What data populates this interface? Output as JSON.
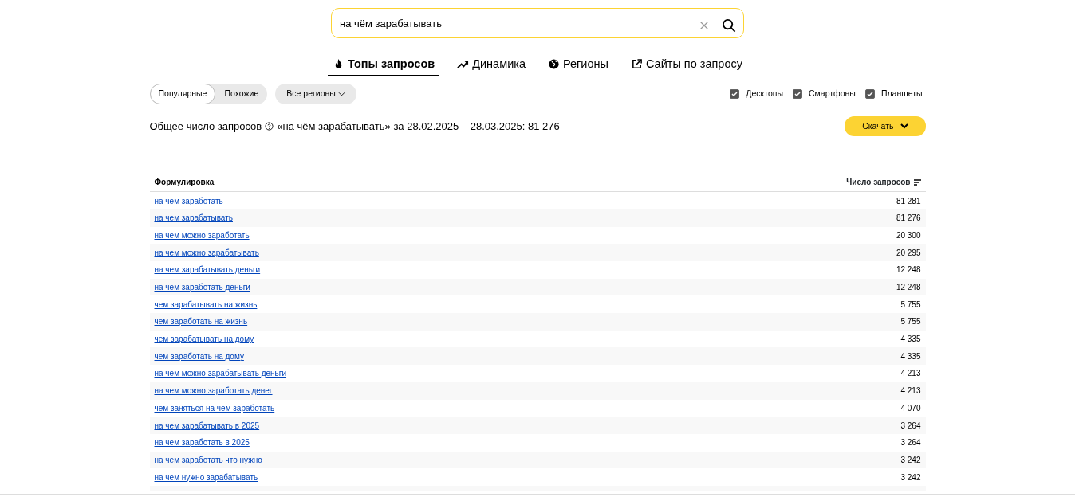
{
  "search": {
    "value": "на чём зарабатывать"
  },
  "tabs": [
    {
      "label": "Топы запросов",
      "selected": true
    },
    {
      "label": "Динамика",
      "selected": false
    },
    {
      "label": "Регионы",
      "selected": false
    },
    {
      "label": "Сайты по запросу",
      "selected": false
    }
  ],
  "modes": [
    {
      "label": "Популярные",
      "selected": true
    },
    {
      "label": "Похожие",
      "selected": false
    }
  ],
  "region_dropdown": {
    "label": "Все регионы"
  },
  "devices": [
    {
      "label": "Десктопы",
      "checked": true
    },
    {
      "label": "Смартфоны",
      "checked": true
    },
    {
      "label": "Планшеты",
      "checked": true
    }
  ],
  "summary": {
    "label": "Общее число запросов",
    "text": "«на чём зарабатывать» за 28.02.2025 – 28.03.2025: 81 276"
  },
  "download_button": {
    "label": "Скачать"
  },
  "table": {
    "columns": [
      "Формулировка",
      "Число запросов"
    ],
    "rows": [
      {
        "phrase": "на чем заработать",
        "count": "81 281"
      },
      {
        "phrase": "на чем зарабатывать",
        "count": "81 276"
      },
      {
        "phrase": "на чем можно заработать",
        "count": "20 300"
      },
      {
        "phrase": "на чем можно зарабатывать",
        "count": "20 295"
      },
      {
        "phrase": "на чем зарабатывать деньги",
        "count": "12 248"
      },
      {
        "phrase": "на чем заработать деньги",
        "count": "12 248"
      },
      {
        "phrase": "чем зарабатывать на жизнь",
        "count": "5 755"
      },
      {
        "phrase": "чем заработать на жизнь",
        "count": "5 755"
      },
      {
        "phrase": "чем зарабатывать на дому",
        "count": "4 335"
      },
      {
        "phrase": "чем заработать на дому",
        "count": "4 335"
      },
      {
        "phrase": "на чем можно зарабатывать деньги",
        "count": "4 213"
      },
      {
        "phrase": "на чем можно заработать денег",
        "count": "4 213"
      },
      {
        "phrase": "чем заняться на чем заработать",
        "count": "4 070"
      },
      {
        "phrase": "на чем зарабатывать в 2025",
        "count": "3 264"
      },
      {
        "phrase": "на чем заработать в 2025",
        "count": "3 264"
      },
      {
        "phrase": "на чем заработать что нужно",
        "count": "3 242"
      },
      {
        "phrase": "на чем нужно зарабатывать",
        "count": "3 242"
      }
    ]
  }
}
